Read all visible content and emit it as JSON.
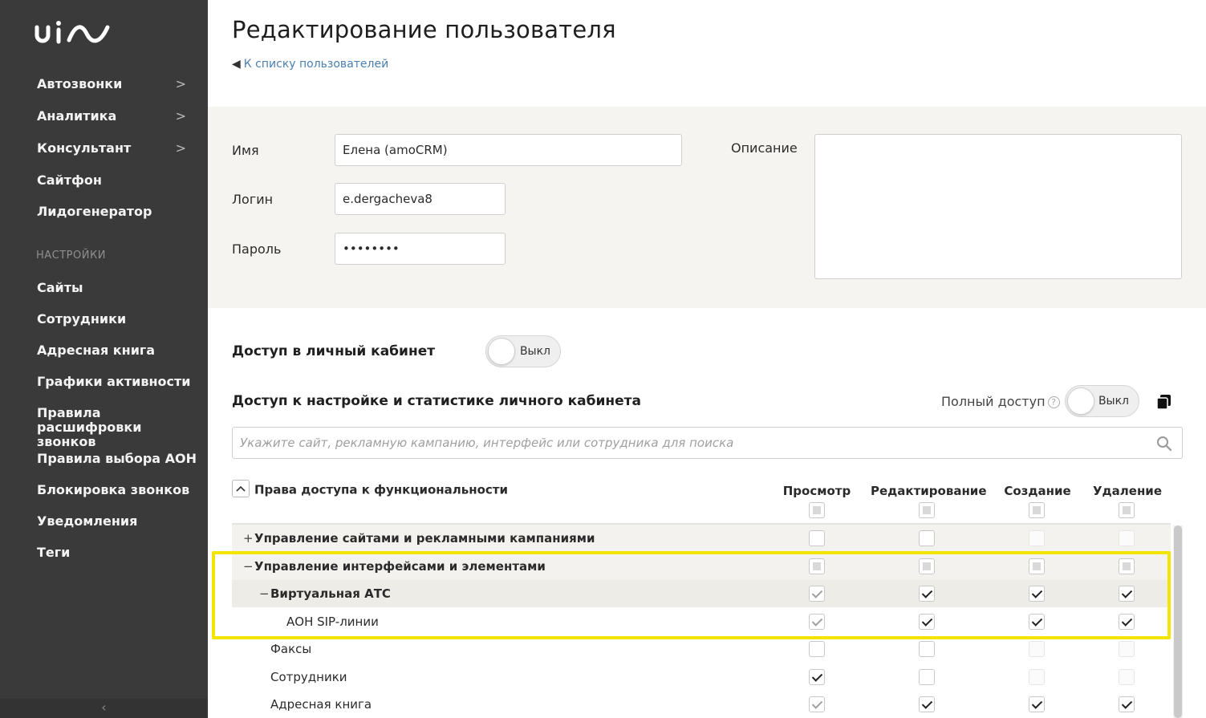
{
  "sidebar": {
    "logo_text": "uis",
    "items": [
      {
        "label": "Автозвонки",
        "chevron": ">"
      },
      {
        "label": "Аналитика",
        "chevron": ">"
      },
      {
        "label": "Консультант",
        "chevron": ">"
      },
      {
        "label": "Сайтфон",
        "chevron": ""
      },
      {
        "label": "Лидогенератор",
        "chevron": ""
      }
    ],
    "settings_section": "НАСТРОЙКИ",
    "settings_items": [
      "Сайты",
      "Сотрудники",
      "Адресная книга",
      "Графики активности",
      "Правила расшифровки звонков",
      "Правила выбора АОН",
      "Блокировка звонков",
      "Уведомления",
      "Теги"
    ],
    "collapse_glyph": "‹"
  },
  "header": {
    "title": "Редактирование пользователя",
    "back_arrow": "🠔",
    "back_link": "К списку пользователей"
  },
  "form": {
    "name_label": "Имя",
    "name_value": "Елена (amoCRM)",
    "login_label": "Логин",
    "login_value": "e.dergacheva8",
    "password_label": "Пароль",
    "password_value": "••••••••",
    "description_label": "Описание",
    "description_value": ""
  },
  "cabinet_access": {
    "label": "Доступ в личный кабинет",
    "toggle": "Выкл"
  },
  "settings_access": {
    "label": "Доступ к настройке и статистике личного кабинета",
    "full_access_label": "Полный доступ",
    "help_glyph": "?",
    "toggle": "Выкл",
    "search_placeholder": "Укажите сайт, рекламную кампанию, интерфейс или сотрудника для поиска"
  },
  "permissions": {
    "header": "Права доступа к функциональности",
    "columns": [
      "Просмотр",
      "Редактирование",
      "Создание",
      "Удаление"
    ],
    "header_checkboxes": [
      "partial",
      "partial",
      "partial",
      "partial"
    ],
    "rows": [
      {
        "label": "Управление сайтами и рекламными кампаниями",
        "sign": "+",
        "level": 0,
        "bold": true,
        "states": [
          "empty",
          "empty",
          "disabled",
          "disabled"
        ]
      },
      {
        "label": "Управление интерфейсами и элементами",
        "sign": "−",
        "level": 0,
        "bold": true,
        "states": [
          "partial",
          "partial",
          "partial",
          "partial"
        ]
      },
      {
        "label": "Виртуальная АТС",
        "sign": "−",
        "level": 1,
        "bold": true,
        "states": [
          "checked-light",
          "checked",
          "checked",
          "checked"
        ]
      },
      {
        "label": "АОН SIP-линии",
        "sign": "",
        "level": 2,
        "bold": false,
        "states": [
          "checked-light",
          "checked",
          "checked",
          "checked"
        ]
      },
      {
        "label": "Факсы",
        "sign": "",
        "level": 1,
        "bold": false,
        "states": [
          "empty",
          "empty",
          "disabled",
          "disabled"
        ]
      },
      {
        "label": "Сотрудники",
        "sign": "",
        "level": 1,
        "bold": false,
        "states": [
          "checked",
          "empty",
          "disabled",
          "disabled"
        ]
      },
      {
        "label": "Адресная книга",
        "sign": "",
        "level": 1,
        "bold": false,
        "states": [
          "checked-light",
          "checked",
          "checked",
          "checked"
        ]
      }
    ]
  },
  "colors": {
    "sidebar_bg": "#3a3a3a",
    "form_panel_bg": "#f6f4f0",
    "link": "#4a7fb0",
    "highlight": "#f3e500"
  }
}
